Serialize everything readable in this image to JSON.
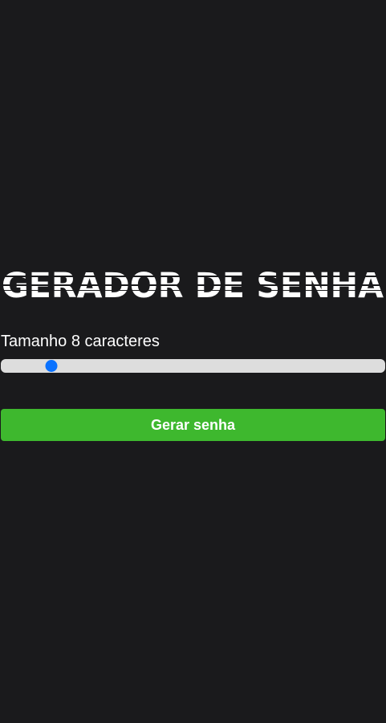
{
  "title": "GERADOR DE SENHA",
  "size_label": "Tamanho 8 caracteres",
  "slider": {
    "min": 6,
    "max": 32,
    "value": 8
  },
  "generate_button": "Gerar senha",
  "colors": {
    "background": "#1a1a1c",
    "accent": "#0a72ff",
    "button": "#3eb82e",
    "track": "#dddddd",
    "text": "#ffffff"
  }
}
